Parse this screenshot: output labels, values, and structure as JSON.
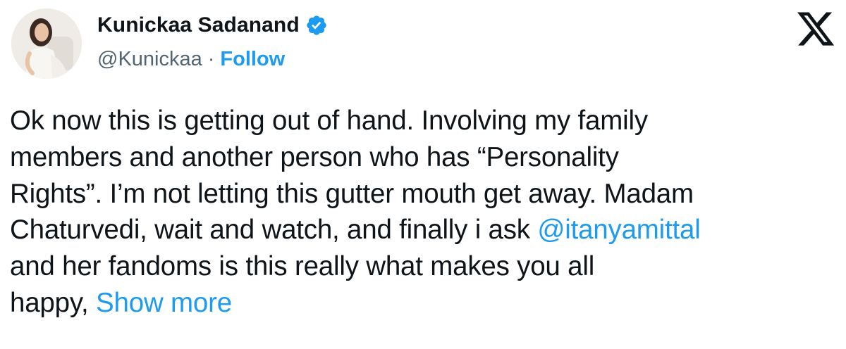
{
  "author": {
    "display_name": "Kunickaa Sadanand",
    "handle": "@Kunickaa",
    "separator": "·",
    "follow_label": "Follow",
    "verified": true
  },
  "tweet": {
    "lines": [
      "Ok now this is getting out of hand. Involving my family",
      "members and another person who has “Personality",
      "Rights”. I’m not letting this gutter mouth get away. Madam"
    ],
    "line4_text": "Chaturvedi, wait and watch, and finally i ask ",
    "mention": "@itanyamittal",
    "line5": "and her fandoms is this really what makes you all",
    "line6_text": "happy, ",
    "show_more_label": "Show more"
  },
  "colors": {
    "accent": "#1d9bf0",
    "text": "#0f1419",
    "secondary": "#536471"
  },
  "icons": {
    "platform_logo": "x-logo-icon",
    "verified_badge": "verified-badge-icon"
  }
}
